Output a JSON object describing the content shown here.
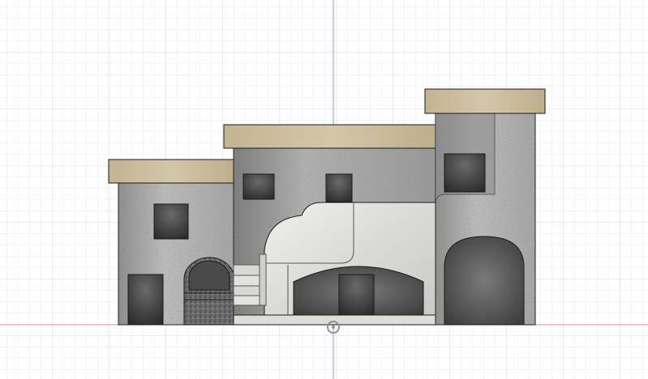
{
  "viewport": {
    "background": "#ffffff",
    "grid_color_minor": "#e6e9ee",
    "grid_color_major": "#cfd5df",
    "axis_vertical_color": "#7a86e0",
    "axis_horizontal_color": "#e08a8a"
  },
  "model": {
    "description_icon": "house-model",
    "roof_color": "#c9b99a",
    "stone_color": "#9d9d9d",
    "plaster_color": "#d6d6d6",
    "window_color": "#3a3a3a",
    "outline_color": "#1a1a1a"
  },
  "origin_marker": {
    "icon": "origin-point-icon"
  }
}
